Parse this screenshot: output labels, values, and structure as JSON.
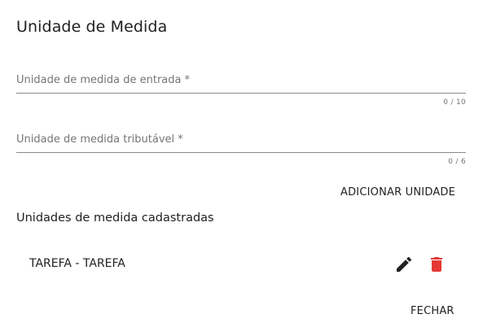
{
  "dialog": {
    "title": "Unidade de Medida"
  },
  "fields": {
    "entrada": {
      "label": "Unidade de medida de entrada *",
      "value": "",
      "counter": "0 / 10"
    },
    "tributavel": {
      "label": "Unidade de medida tributável *",
      "value": "",
      "counter": "0 / 6"
    }
  },
  "actions": {
    "add_label": "ADICIONAR UNIDADE",
    "close_label": "FECHAR"
  },
  "list": {
    "title": "Unidades de medida cadastradas",
    "items": [
      {
        "label": "TAREFA - TAREFA"
      }
    ]
  },
  "icons": {
    "edit": "pencil-icon",
    "delete": "trash-icon"
  },
  "colors": {
    "delete": "#e53935",
    "edit": "#212121",
    "underline": "#8a8a8a"
  }
}
